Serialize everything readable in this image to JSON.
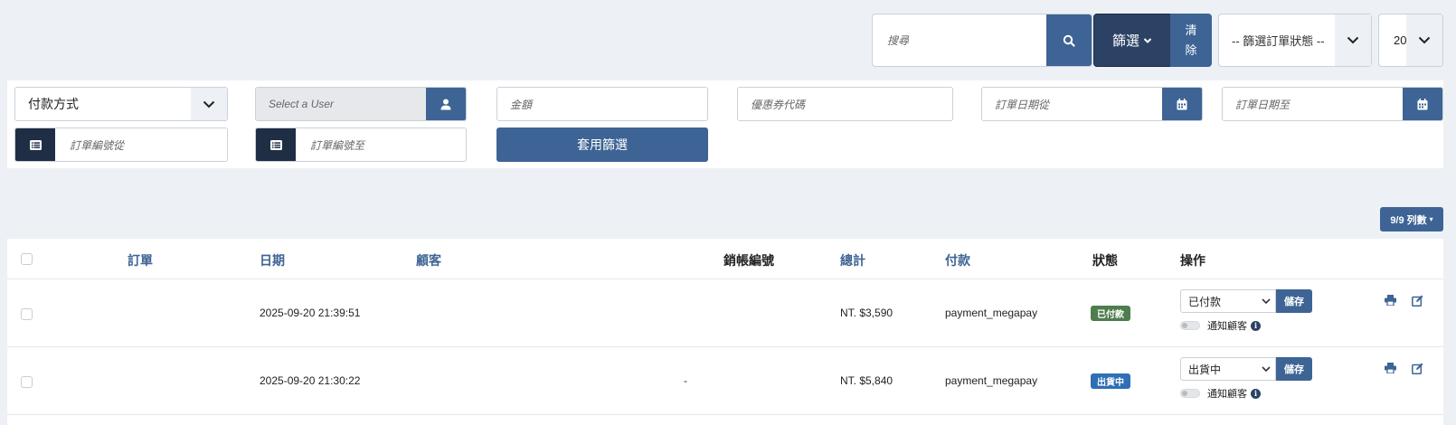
{
  "toolbar": {
    "search_placeholder": "搜尋",
    "filter_label": "篩選",
    "clear_label_line1": "清",
    "clear_label_line2": "除",
    "status_select_value": "-- 篩選訂單狀態 --",
    "per_page_value": "20"
  },
  "filters": {
    "payment_method_value": "付款方式",
    "user_placeholder": "Select a User",
    "amount_placeholder": "金額",
    "coupon_placeholder": "優惠券代碼",
    "date_from_placeholder": "訂單日期從",
    "date_to_placeholder": "訂單日期至",
    "order_no_from_placeholder": "訂單編號從",
    "order_no_to_placeholder": "訂單編號至",
    "apply_label": "套用篩選"
  },
  "columns_button": "9/9 列數",
  "table": {
    "headers": {
      "order": "訂單",
      "date": "日期",
      "customer": "顧客",
      "invoice": "銷帳編號",
      "total": "總計",
      "payment": "付款",
      "status": "狀態",
      "actions": "操作"
    },
    "rows": [
      {
        "order": "",
        "date": "2025-09-20 21:39:51",
        "customer": "",
        "invoice": "",
        "total": "NT. $3,590",
        "payment": "payment_megapay",
        "status": "已付款",
        "status_color": "#4e7d4e",
        "action_value": "已付款",
        "save_label": "儲存",
        "notify_label": "通知顧客"
      },
      {
        "order": "",
        "date": "2025-09-20 21:30:22",
        "customer": "",
        "invoice": "-",
        "total": "NT. $5,840",
        "payment": "payment_megapay",
        "status": "出貨中",
        "status_color": "#2e6fb5",
        "action_value": "出貨中",
        "save_label": "儲存",
        "notify_label": "通知顧客"
      }
    ]
  }
}
